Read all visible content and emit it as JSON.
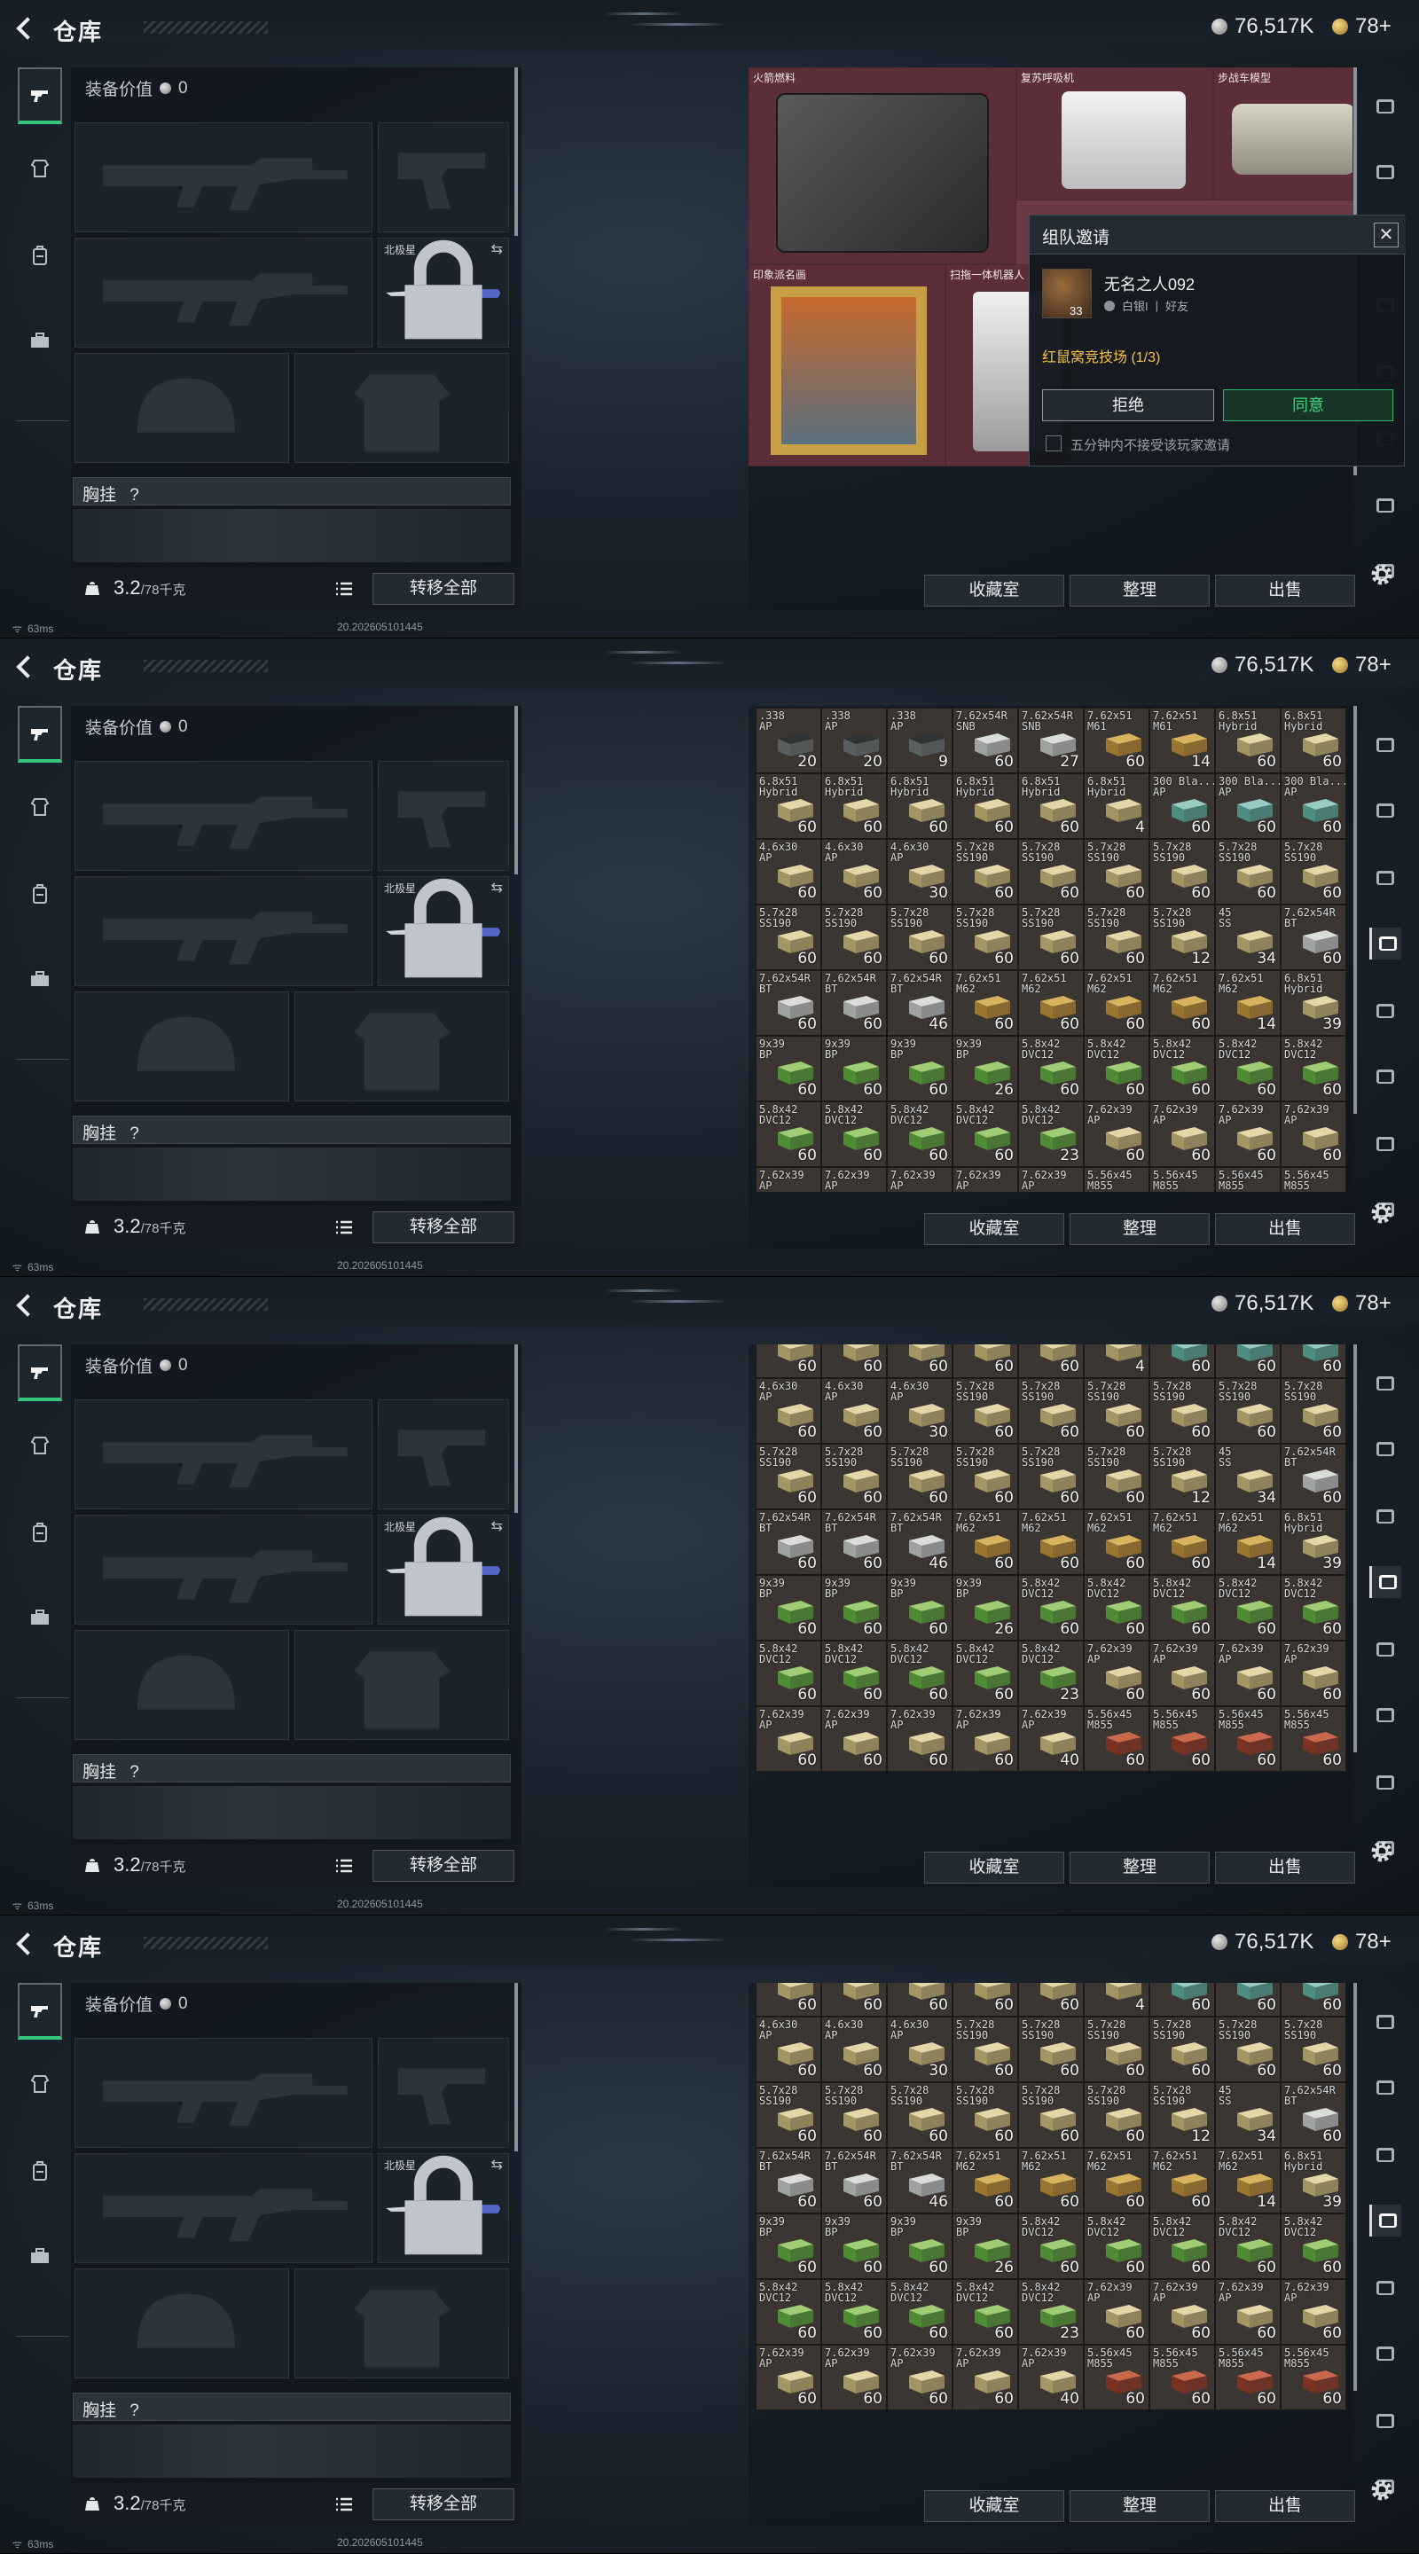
{
  "header": {
    "title": "仓库",
    "currency_value": "76,517K",
    "tickets_value": "78+"
  },
  "loadout": {
    "equip_value_label": "装备价值",
    "equip_value": "0",
    "secondary_slot_label": "北极星",
    "vest_label": "胸挂",
    "vest_help": "?",
    "weight_value": "3.2",
    "weight_capacity": "/78千克",
    "transfer_all_label": "转移全部"
  },
  "storage_actions": {
    "collection_label": "收藏室",
    "sort_label": "整理",
    "sell_label": "出售"
  },
  "collection_items": [
    {
      "label": "火箭燃料"
    },
    {
      "label": "复苏呼吸机"
    },
    {
      "label": "步战车模型"
    },
    {
      "label": "印象派名画"
    },
    {
      "label": "扫拖一体机器人"
    }
  ],
  "invite_dialog": {
    "title": "组队邀请",
    "player_name": "无名之人092",
    "player_level": "33",
    "player_rank": "白银I",
    "player_relation": "好友",
    "mode": "红鼠窝竞技场 (1/3)",
    "decline_label": "拒绝",
    "accept_label": "同意",
    "mute_option": "五分钟内不接受该玩家邀请"
  },
  "status": {
    "ping": "63ms",
    "build": "20.202605101445"
  },
  "ammo_rows": [
    [
      {
        "n1": ".338",
        "n2": "AP",
        "count": "20",
        "color": "dark"
      },
      {
        "n1": ".338",
        "n2": "AP",
        "count": "20",
        "color": "dark"
      },
      {
        "n1": ".338",
        "n2": "AP",
        "count": "9",
        "color": "dark"
      },
      {
        "n1": "7.62x54R",
        "n2": "SNB",
        "count": "60",
        "color": "white"
      },
      {
        "n1": "7.62x54R",
        "n2": "SNB",
        "count": "27",
        "color": "white"
      },
      {
        "n1": "7.62x51",
        "n2": "M61",
        "count": "60",
        "color": "tan"
      },
      {
        "n1": "7.62x51",
        "n2": "M61",
        "count": "14",
        "color": "tan"
      },
      {
        "n1": "6.8x51",
        "n2": "Hybrid",
        "count": "60",
        "color": "cream"
      },
      {
        "n1": "6.8x51",
        "n2": "Hybrid",
        "count": "60",
        "color": "cream"
      }
    ],
    [
      {
        "n1": "6.8x51",
        "n2": "Hybrid",
        "count": "60",
        "color": "cream"
      },
      {
        "n1": "6.8x51",
        "n2": "Hybrid",
        "count": "60",
        "color": "cream"
      },
      {
        "n1": "6.8x51",
        "n2": "Hybrid",
        "count": "60",
        "color": "cream"
      },
      {
        "n1": "6.8x51",
        "n2": "Hybrid",
        "count": "60",
        "color": "cream"
      },
      {
        "n1": "6.8x51",
        "n2": "Hybrid",
        "count": "60",
        "color": "cream"
      },
      {
        "n1": "6.8x51",
        "n2": "Hybrid",
        "count": "4",
        "color": "cream"
      },
      {
        "n1": "300 Bla...",
        "n2": "AP",
        "count": "60",
        "color": "teal"
      },
      {
        "n1": "300 Bla...",
        "n2": "AP",
        "count": "60",
        "color": "teal"
      },
      {
        "n1": "300 Bla...",
        "n2": "AP",
        "count": "60",
        "color": "teal"
      }
    ],
    [
      {
        "n1": "4.6x30",
        "n2": "AP",
        "count": "60",
        "color": "cream"
      },
      {
        "n1": "4.6x30",
        "n2": "AP",
        "count": "60",
        "color": "cream"
      },
      {
        "n1": "4.6x30",
        "n2": "AP",
        "count": "30",
        "color": "cream"
      },
      {
        "n1": "5.7x28",
        "n2": "SS190",
        "count": "60",
        "color": "cream"
      },
      {
        "n1": "5.7x28",
        "n2": "SS190",
        "count": "60",
        "color": "cream"
      },
      {
        "n1": "5.7x28",
        "n2": "SS190",
        "count": "60",
        "color": "cream"
      },
      {
        "n1": "5.7x28",
        "n2": "SS190",
        "count": "60",
        "color": "cream"
      },
      {
        "n1": "5.7x28",
        "n2": "SS190",
        "count": "60",
        "color": "cream"
      },
      {
        "n1": "5.7x28",
        "n2": "SS190",
        "count": "60",
        "color": "cream"
      }
    ],
    [
      {
        "n1": "5.7x28",
        "n2": "SS190",
        "count": "60",
        "color": "cream"
      },
      {
        "n1": "5.7x28",
        "n2": "SS190",
        "count": "60",
        "color": "cream"
      },
      {
        "n1": "5.7x28",
        "n2": "SS190",
        "count": "60",
        "color": "cream"
      },
      {
        "n1": "5.7x28",
        "n2": "SS190",
        "count": "60",
        "color": "cream"
      },
      {
        "n1": "5.7x28",
        "n2": "SS190",
        "count": "60",
        "color": "cream"
      },
      {
        "n1": "5.7x28",
        "n2": "SS190",
        "count": "60",
        "color": "cream"
      },
      {
        "n1": "5.7x28",
        "n2": "SS190",
        "count": "12",
        "color": "cream"
      },
      {
        "n1": "45",
        "n2": "SS",
        "count": "34",
        "color": "cream"
      },
      {
        "n1": "7.62x54R",
        "n2": "BT",
        "count": "60",
        "color": "white"
      }
    ],
    [
      {
        "n1": "7.62x54R",
        "n2": "BT",
        "count": "60",
        "color": "white"
      },
      {
        "n1": "7.62x54R",
        "n2": "BT",
        "count": "60",
        "color": "white"
      },
      {
        "n1": "7.62x54R",
        "n2": "BT",
        "count": "46",
        "color": "white"
      },
      {
        "n1": "7.62x51",
        "n2": "M62",
        "count": "60",
        "color": "tan"
      },
      {
        "n1": "7.62x51",
        "n2": "M62",
        "count": "60",
        "color": "tan"
      },
      {
        "n1": "7.62x51",
        "n2": "M62",
        "count": "60",
        "color": "tan"
      },
      {
        "n1": "7.62x51",
        "n2": "M62",
        "count": "60",
        "color": "tan"
      },
      {
        "n1": "7.62x51",
        "n2": "M62",
        "count": "14",
        "color": "tan"
      },
      {
        "n1": "6.8x51",
        "n2": "Hybrid",
        "count": "39",
        "color": "cream"
      }
    ],
    [
      {
        "n1": "9x39",
        "n2": "BP",
        "count": "60",
        "color": "green"
      },
      {
        "n1": "9x39",
        "n2": "BP",
        "count": "60",
        "color": "green"
      },
      {
        "n1": "9x39",
        "n2": "BP",
        "count": "60",
        "color": "green"
      },
      {
        "n1": "9x39",
        "n2": "BP",
        "count": "26",
        "color": "green"
      },
      {
        "n1": "5.8x42",
        "n2": "DVC12",
        "count": "60",
        "color": "green"
      },
      {
        "n1": "5.8x42",
        "n2": "DVC12",
        "count": "60",
        "color": "green"
      },
      {
        "n1": "5.8x42",
        "n2": "DVC12",
        "count": "60",
        "color": "green"
      },
      {
        "n1": "5.8x42",
        "n2": "DVC12",
        "count": "60",
        "color": "green"
      },
      {
        "n1": "5.8x42",
        "n2": "DVC12",
        "count": "60",
        "color": "green"
      }
    ],
    [
      {
        "n1": "5.8x42",
        "n2": "DVC12",
        "count": "60",
        "color": "green"
      },
      {
        "n1": "5.8x42",
        "n2": "DVC12",
        "count": "60",
        "color": "green"
      },
      {
        "n1": "5.8x42",
        "n2": "DVC12",
        "count": "60",
        "color": "green"
      },
      {
        "n1": "5.8x42",
        "n2": "DVC12",
        "count": "60",
        "color": "green"
      },
      {
        "n1": "5.8x42",
        "n2": "DVC12",
        "count": "23",
        "color": "green"
      },
      {
        "n1": "7.62x39",
        "n2": "AP",
        "count": "60",
        "color": "cream"
      },
      {
        "n1": "7.62x39",
        "n2": "AP",
        "count": "60",
        "color": "cream"
      },
      {
        "n1": "7.62x39",
        "n2": "AP",
        "count": "60",
        "color": "cream"
      },
      {
        "n1": "7.62x39",
        "n2": "AP",
        "count": "60",
        "color": "cream"
      }
    ],
    [
      {
        "n1": "7.62x39",
        "n2": "AP",
        "count": "60",
        "color": "cream"
      },
      {
        "n1": "7.62x39",
        "n2": "AP",
        "count": "60",
        "color": "cream"
      },
      {
        "n1": "7.62x39",
        "n2": "AP",
        "count": "60",
        "color": "cream"
      },
      {
        "n1": "7.62x39",
        "n2": "AP",
        "count": "60",
        "color": "cream"
      },
      {
        "n1": "7.62x39",
        "n2": "AP",
        "count": "40",
        "color": "cream"
      },
      {
        "n1": "5.56x45",
        "n2": "M855",
        "count": "60",
        "color": "red"
      },
      {
        "n1": "5.56x45",
        "n2": "M855",
        "count": "60",
        "color": "red"
      },
      {
        "n1": "5.56x45",
        "n2": "M855",
        "count": "60",
        "color": "red"
      },
      {
        "n1": "5.56x45",
        "n2": "M855",
        "count": "60",
        "color": "red"
      }
    ]
  ],
  "colors": {
    "accent_green": "#33c87a",
    "cell_bg": "#3b3632",
    "collection_bg": "#6b3a44",
    "invite_mode": "#f0c34a"
  },
  "icons": [
    "back-arrow-icon",
    "silver-coin-icon",
    "gold-ticket-icon",
    "gun-icon",
    "armor-icon",
    "backpack-icon",
    "briefcase-icon",
    "lock-icon",
    "swap-icon",
    "list-icon",
    "settings-gear-icon",
    "close-icon",
    "wifi-icon"
  ]
}
